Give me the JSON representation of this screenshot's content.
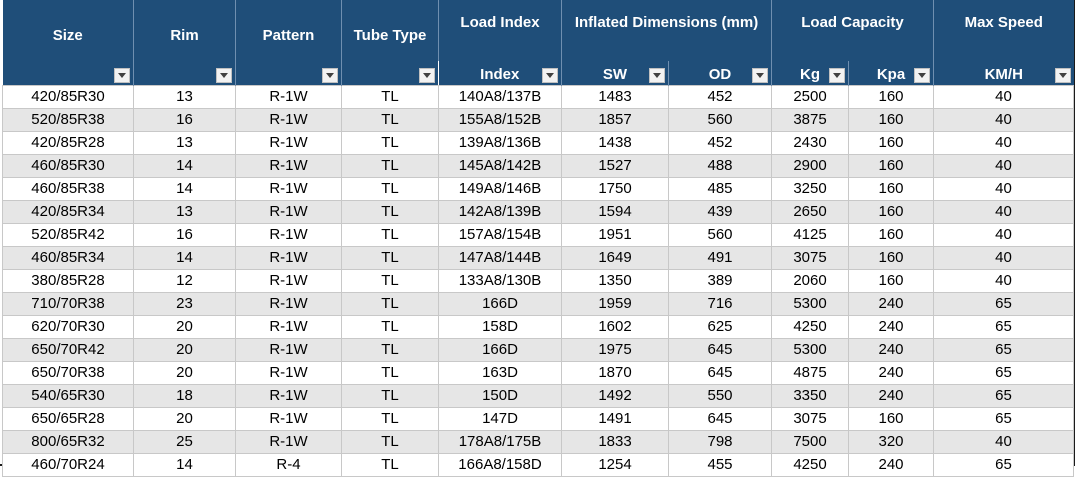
{
  "headers": {
    "size": "Size",
    "rim": "Rim",
    "pattern": "Pattern",
    "tube_type": "Tube Type",
    "load_index_group": "Load Index",
    "index": "Index",
    "inflated_group": "Inflated Dimensions (mm)",
    "sw": "SW",
    "od": "OD",
    "load_capacity_group": "Load Capacity",
    "kg": "Kg",
    "kpa": "Kpa",
    "max_speed_group": "Max Speed",
    "kmh": "KM/H"
  },
  "rows": [
    [
      "420/85R30",
      "13",
      "R-1W",
      "TL",
      "140A8/137B",
      "1483",
      "452",
      "2500",
      "160",
      "40"
    ],
    [
      "520/85R38",
      "16",
      "R-1W",
      "TL",
      "155A8/152B",
      "1857",
      "560",
      "3875",
      "160",
      "40"
    ],
    [
      "420/85R28",
      "13",
      "R-1W",
      "TL",
      "139A8/136B",
      "1438",
      "452",
      "2430",
      "160",
      "40"
    ],
    [
      "460/85R30",
      "14",
      "R-1W",
      "TL",
      "145A8/142B",
      "1527",
      "488",
      "2900",
      "160",
      "40"
    ],
    [
      "460/85R38",
      "14",
      "R-1W",
      "TL",
      "149A8/146B",
      "1750",
      "485",
      "3250",
      "160",
      "40"
    ],
    [
      "420/85R34",
      "13",
      "R-1W",
      "TL",
      "142A8/139B",
      "1594",
      "439",
      "2650",
      "160",
      "40"
    ],
    [
      "520/85R42",
      "16",
      "R-1W",
      "TL",
      "157A8/154B",
      "1951",
      "560",
      "4125",
      "160",
      "40"
    ],
    [
      "460/85R34",
      "14",
      "R-1W",
      "TL",
      "147A8/144B",
      "1649",
      "491",
      "3075",
      "160",
      "40"
    ],
    [
      "380/85R28",
      "12",
      "R-1W",
      "TL",
      "133A8/130B",
      "1350",
      "389",
      "2060",
      "160",
      "40"
    ],
    [
      "710/70R38",
      "23",
      "R-1W",
      "TL",
      "166D",
      "1959",
      "716",
      "5300",
      "240",
      "65"
    ],
    [
      "620/70R30",
      "20",
      "R-1W",
      "TL",
      "158D",
      "1602",
      "625",
      "4250",
      "240",
      "65"
    ],
    [
      "650/70R42",
      "20",
      "R-1W",
      "TL",
      "166D",
      "1975",
      "645",
      "5300",
      "240",
      "65"
    ],
    [
      "650/70R38",
      "20",
      "R-1W",
      "TL",
      "163D",
      "1870",
      "645",
      "4875",
      "240",
      "65"
    ],
    [
      "540/65R30",
      "18",
      "R-1W",
      "TL",
      "150D",
      "1492",
      "550",
      "3350",
      "240",
      "65"
    ],
    [
      "650/65R28",
      "20",
      "R-1W",
      "TL",
      "147D",
      "1491",
      "645",
      "3075",
      "160",
      "65"
    ],
    [
      "800/65R32",
      "25",
      "R-1W",
      "TL",
      "178A8/175B",
      "1833",
      "798",
      "7500",
      "320",
      "40"
    ],
    [
      "460/70R24",
      "14",
      "R-4",
      "TL",
      "166A8/158D",
      "1254",
      "455",
      "4250",
      "240",
      "65"
    ]
  ],
  "colors": {
    "header_bg": "#1f4e79",
    "header_text": "#ffffff",
    "row_alt_bg": "#e6e6e6"
  },
  "icons": {
    "filter": "filter-dropdown-icon"
  }
}
